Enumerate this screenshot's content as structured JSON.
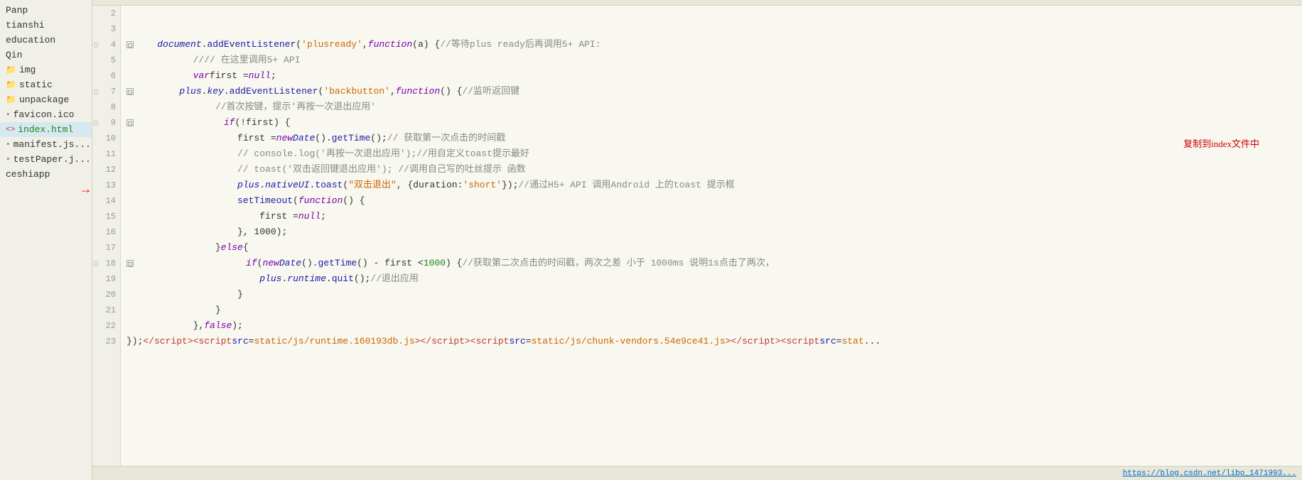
{
  "sidebar": {
    "items": [
      {
        "label": "Panp",
        "type": "plain",
        "active": false
      },
      {
        "label": "tianshi",
        "type": "plain",
        "active": false
      },
      {
        "label": "education",
        "type": "plain",
        "active": false
      },
      {
        "label": "Qin",
        "type": "plain",
        "active": false
      },
      {
        "label": "img",
        "type": "folder",
        "active": false
      },
      {
        "label": "static",
        "type": "folder",
        "active": false
      },
      {
        "label": "unpackage",
        "type": "folder",
        "active": false
      },
      {
        "label": "favicon.ico",
        "type": "file",
        "active": false
      },
      {
        "label": "index.html",
        "type": "html",
        "active": true
      },
      {
        "label": "manifest.js...",
        "type": "file",
        "active": false
      },
      {
        "label": "testPaper.j...",
        "type": "file",
        "active": false
      },
      {
        "label": "ceshiapp",
        "type": "plain",
        "active": false
      }
    ]
  },
  "editor": {
    "annotation": "复制到index文件中"
  },
  "bottom_bar": {
    "url": "https://blog.csdn.net/",
    "url_display": "https://blog.csdn.net/libo_1471993..."
  },
  "lines": [
    {
      "num": 2,
      "content": "",
      "fold": false
    },
    {
      "num": 3,
      "content": "",
      "fold": false
    },
    {
      "num": 4,
      "content": "document_addEventListener_plusready",
      "fold": true
    },
    {
      "num": 5,
      "content": "comment_5plus_api",
      "fold": false
    },
    {
      "num": 6,
      "content": "var_first_null",
      "fold": false
    },
    {
      "num": 7,
      "content": "plus_key_addEventlistener",
      "fold": true
    },
    {
      "num": 8,
      "content": "",
      "fold": false
    },
    {
      "num": 9,
      "content": "if_first",
      "fold": true
    },
    {
      "num": 10,
      "content": "first_new_date_gettime",
      "fold": false
    },
    {
      "num": 11,
      "content": "comment_console_log",
      "fold": false
    },
    {
      "num": 12,
      "content": "comment_toast",
      "fold": false
    },
    {
      "num": 13,
      "content": "plus_nativeui_toast",
      "fold": false
    },
    {
      "num": 14,
      "content": "settimeout",
      "fold": false
    },
    {
      "num": 15,
      "content": "first_null",
      "fold": false
    },
    {
      "num": 16,
      "content": "close_settimeout",
      "fold": false
    },
    {
      "num": 17,
      "content": "else",
      "fold": false
    },
    {
      "num": 18,
      "content": "if_new_date",
      "fold": true
    },
    {
      "num": 19,
      "content": "plus_runtime_quit",
      "fold": false
    },
    {
      "num": 20,
      "content": "close_if",
      "fold": false
    },
    {
      "num": 21,
      "content": "close_else",
      "fold": false
    },
    {
      "num": 22,
      "content": "false",
      "fold": false
    },
    {
      "num": 23,
      "content": "script_tags",
      "fold": false
    }
  ]
}
